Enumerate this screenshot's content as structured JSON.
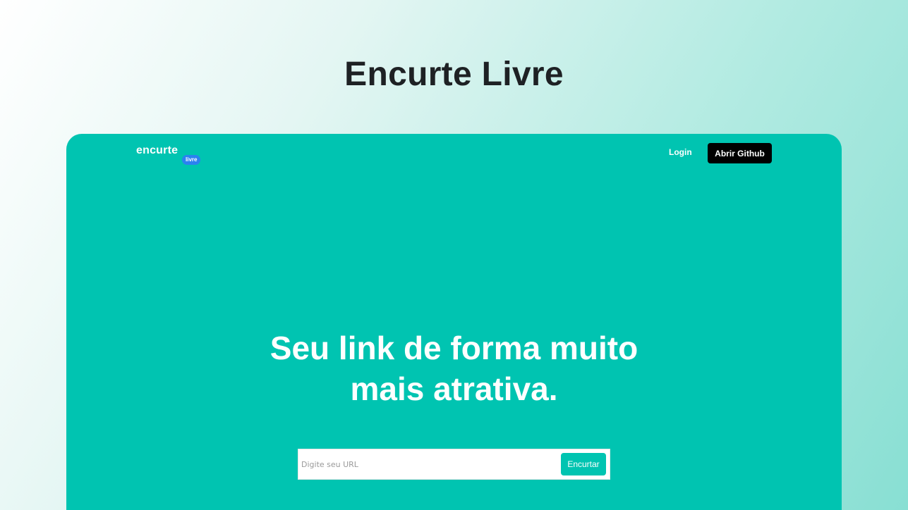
{
  "page": {
    "heading": "Encurte Livre"
  },
  "app": {
    "logo": {
      "word": "encurte",
      "badge": "livre"
    },
    "nav": {
      "login_label": "Login",
      "github_label": "Abrir Github"
    },
    "hero": {
      "title_line1": "Seu link de forma muito",
      "title_line2": "mais atrativa."
    },
    "form": {
      "url_placeholder": "Digite seu URL",
      "url_value": "",
      "submit_label": "Encurtar"
    }
  },
  "colors": {
    "brand_teal": "#00c4b1",
    "badge_blue": "#2b82f0",
    "github_button": "#000000",
    "heading_text": "#1e2124"
  }
}
